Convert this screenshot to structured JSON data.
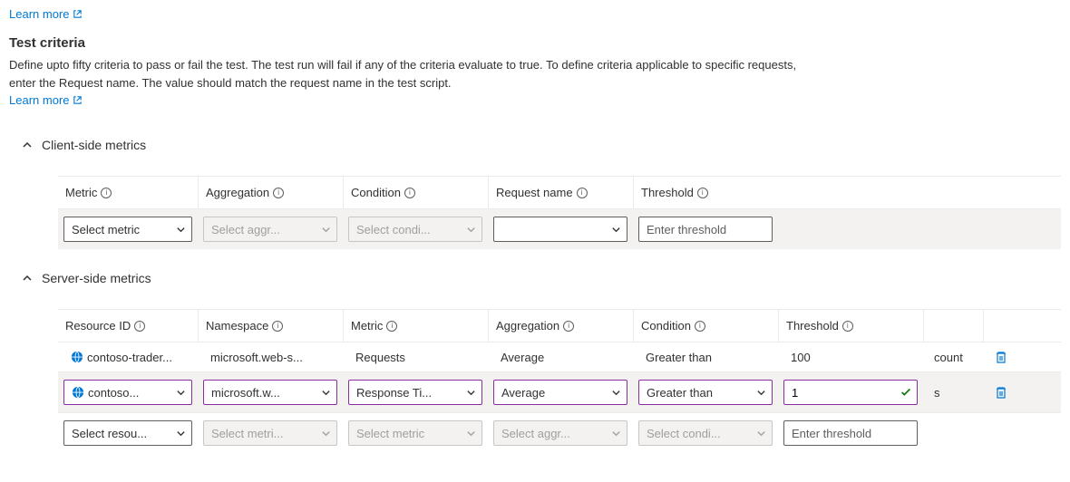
{
  "links": {
    "learn_more": "Learn more"
  },
  "test_criteria": {
    "title": "Test criteria",
    "description": "Define upto fifty criteria to pass or fail the test. The test run will fail if any of the criteria evaluate to true. To define criteria applicable to specific requests, enter the Request name. The value should match the request name in the test script."
  },
  "client": {
    "title": "Client-side metrics",
    "headers": {
      "metric": "Metric",
      "aggregation": "Aggregation",
      "condition": "Condition",
      "request_name": "Request name",
      "threshold": "Threshold"
    },
    "placeholders": {
      "metric": "Select metric",
      "aggregation": "Select aggr...",
      "condition": "Select condi...",
      "request_name": "",
      "threshold": "Enter threshold"
    }
  },
  "server": {
    "title": "Server-side metrics",
    "headers": {
      "resource_id": "Resource ID",
      "namespace": "Namespace",
      "metric": "Metric",
      "aggregation": "Aggregation",
      "condition": "Condition",
      "threshold": "Threshold"
    },
    "rows": [
      {
        "resource_id": "contoso-trader...",
        "namespace": "microsoft.web-s...",
        "metric": "Requests",
        "aggregation": "Average",
        "condition": "Greater than",
        "threshold": "100",
        "unit": "count"
      },
      {
        "resource_id": "contoso...",
        "namespace": "microsoft.w...",
        "metric": "Response Ti...",
        "aggregation": "Average",
        "condition": "Greater than",
        "threshold": "1",
        "unit": "s"
      }
    ],
    "placeholders": {
      "resource_id": "Select resou...",
      "namespace": "Select metri...",
      "metric": "Select metric",
      "aggregation": "Select aggr...",
      "condition": "Select condi...",
      "threshold": "Enter threshold"
    }
  }
}
